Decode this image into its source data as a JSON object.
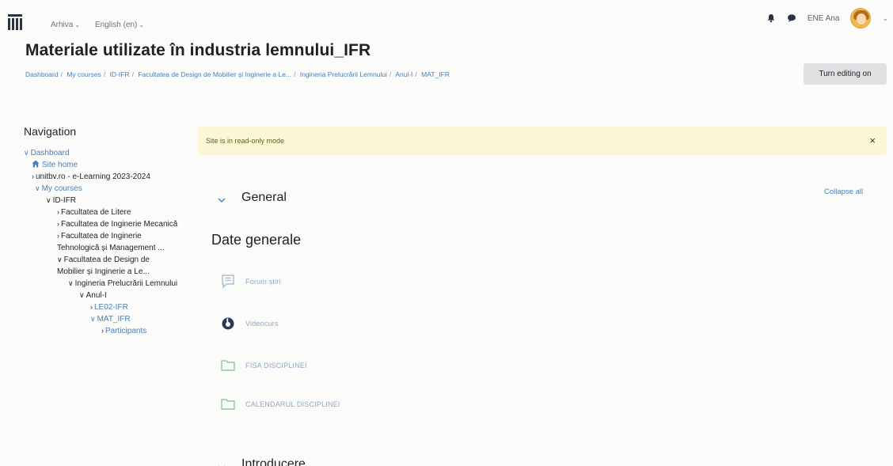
{
  "navbar": {
    "archive_label": "Arhiva",
    "language_label": "English (en)",
    "user_name": "ENE Ana"
  },
  "header": {
    "course_title": "Materiale utilizate în industria lemnului_IFR",
    "breadcrumb": [
      "Dashboard",
      "My courses",
      "ID-IFR",
      "Facultatea de Design de Mobilier și Inginerie a Le...",
      "Ingineria Prelucrării Lemnului",
      "Anul-I",
      "MAT_IFR"
    ],
    "edit_button": "Turn editing on"
  },
  "navigation": {
    "title": "Navigation",
    "items": [
      {
        "label": "Dashboard"
      },
      {
        "label": "Site home"
      },
      {
        "label": "unitbv.ro - e-Learning 2023-2024"
      },
      {
        "label": "My courses"
      },
      {
        "label": "ID-IFR"
      },
      {
        "label": "Facultatea de Litere"
      },
      {
        "label": "Facultatea de Inginerie Mecanică"
      },
      {
        "label": "Facultatea de Inginerie Tehnologică și Management ..."
      },
      {
        "label": "Facultatea de Design de Mobilier și Inginerie a Le..."
      },
      {
        "label": "Ingineria Prelucrării Lemnului"
      },
      {
        "label": "Anul-I"
      },
      {
        "label": "LE02-IFR"
      },
      {
        "label": "MAT_IFR"
      },
      {
        "label": "Participants"
      }
    ]
  },
  "main": {
    "alert_text": "Site is in read-only mode",
    "alert_close": "×",
    "collapse_all": "Collapse all",
    "sections": [
      {
        "name": "General"
      },
      {
        "name": "Introducere"
      }
    ],
    "subheading": "Date generale",
    "activities": [
      {
        "label": "Forum știri",
        "icon": "forum-icon"
      },
      {
        "label": "Videocurs",
        "icon": "video-icon"
      },
      {
        "label": "FISA DISCIPLINEI",
        "icon": "folder-icon"
      },
      {
        "label": "CALENDARUL DISCIPLINEI",
        "icon": "folder-icon"
      }
    ]
  },
  "colors": {
    "link": "#4a7fb5",
    "alert_bg": "#fbf6d6",
    "button_bg": "#dfe1e3"
  }
}
